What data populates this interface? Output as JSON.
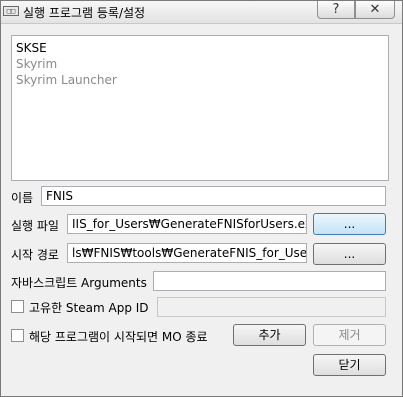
{
  "window": {
    "title": "실행 프로그램 등록/설정",
    "app_icon_text": "□□",
    "help_button": "?",
    "close_button": "✕"
  },
  "executables": [
    {
      "label": "SKSE",
      "enabled": true
    },
    {
      "label": "Skyrim",
      "enabled": false
    },
    {
      "label": "Skyrim Launcher",
      "enabled": false
    }
  ],
  "form": {
    "name_label": "이름",
    "name_value": "FNIS",
    "binary_label": "실행 파일",
    "binary_value": "IIS_for_Users₩GenerateFNISforUsers.exe",
    "binary_browse": "...",
    "start_in_label": "시작 경로",
    "start_in_value": "ls₩FNIS₩tools₩GenerateFNIS_for_Users",
    "start_in_browse": "...",
    "arguments_label": "자바스크립트 Arguments",
    "arguments_value": "",
    "steam_appid_label": "고유한 Steam App ID",
    "steam_appid_value": "",
    "close_mo_label": "해당 프로그램이 시작되면 MO 종료"
  },
  "buttons": {
    "add": "추가",
    "remove": "제거",
    "close": "닫기"
  }
}
